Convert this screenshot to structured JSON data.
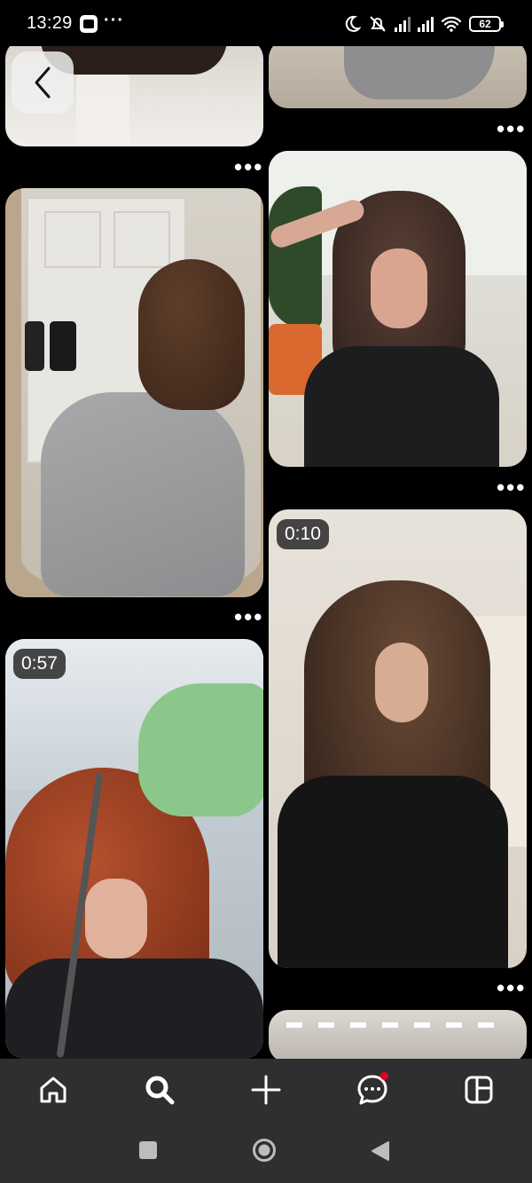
{
  "status_bar": {
    "time": "13:29",
    "battery": "62",
    "overflow": "···"
  },
  "feed": {
    "pins": [
      {
        "id": "pin-1",
        "type": "image"
      },
      {
        "id": "pin-2",
        "type": "image"
      },
      {
        "id": "pin-3",
        "type": "image"
      },
      {
        "id": "pin-4",
        "type": "image"
      },
      {
        "id": "pin-5",
        "type": "video",
        "duration": "0:10"
      },
      {
        "id": "pin-6",
        "type": "video",
        "duration": "0:57"
      },
      {
        "id": "pin-7",
        "type": "image"
      }
    ],
    "more_label": "•••"
  },
  "bottom_nav": {
    "items": [
      {
        "name": "home",
        "icon": "home-icon"
      },
      {
        "name": "search",
        "icon": "search-icon",
        "active": true
      },
      {
        "name": "create",
        "icon": "plus-icon"
      },
      {
        "name": "messages",
        "icon": "chat-icon",
        "notification": true
      },
      {
        "name": "profile",
        "icon": "boards-icon"
      }
    ]
  },
  "system_nav": {
    "items": [
      "recents",
      "home",
      "back"
    ]
  },
  "colors": {
    "background": "#000000",
    "nav_bar": "#2f2f2f",
    "notification_dot": "#e60023"
  }
}
